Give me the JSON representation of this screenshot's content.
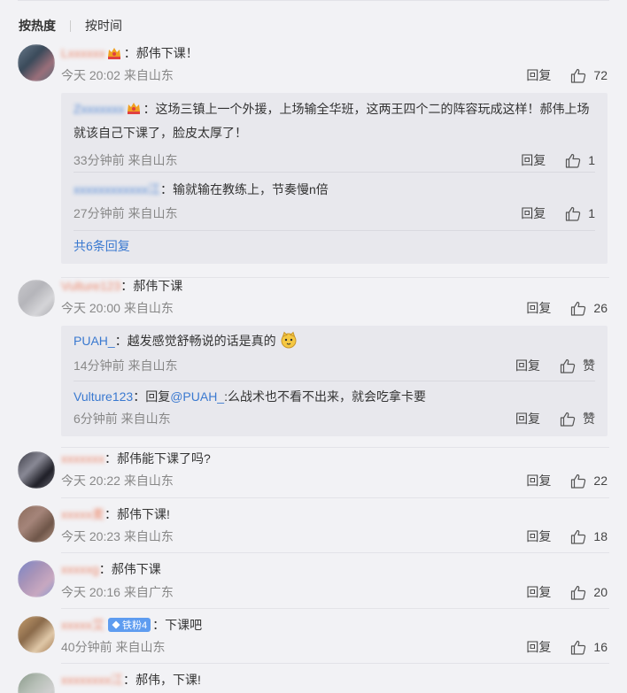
{
  "sort": {
    "hot": "按热度",
    "time": "按时间"
  },
  "comments": [
    {
      "user": "Lxxxxxx",
      "text": "：郝伟下课！",
      "meta": "今天 20:02 来自山东",
      "reply": "回复",
      "likes": "72",
      "avatar_colors": [
        "#6a7b8c",
        "#3a4a5a",
        "#9a6f7a",
        "#5b6b7b"
      ],
      "subreplies": [
        {
          "user": "Zxxxxxxx",
          "text": "：这场三镇上一个外援，上场输全华班，这两王四个二的阵容玩成这样！郝伟上场就该自己下课了，脸皮太厚了！",
          "meta": "33分钟前 来自山东",
          "reply": "回复",
          "likes": "1"
        },
        {
          "user": "xxxxxxxxxxxx江",
          "text": "：输就输在教练上，节奏慢n倍",
          "meta": "27分钟前 来自山东",
          "reply": "回复",
          "likes": "1"
        }
      ],
      "more": "共6条回复"
    },
    {
      "user": "Vulture123",
      "text": "：郝伟下课",
      "meta": "今天 20:00 来自山东",
      "reply": "回复",
      "likes": "26",
      "avatar_colors": [
        "#c8c8cc",
        "#b5b5ba",
        "#d5d5d8",
        "#a9a9ae"
      ],
      "subreplies": [
        {
          "user": "PUAH_",
          "text": "：越发感觉舒畅说的话是真的",
          "meta": "14分钟前 来自山东",
          "reply": "回复",
          "likes": "赞"
        },
        {
          "user": "Vulture123",
          "text": "：回复",
          "mention": "@PUAH_",
          "text2": ":么战术也不看不出来，就会吃拿卡要",
          "meta": "6分钟前 来自山东",
          "reply": "回复",
          "likes": "赞"
        }
      ]
    },
    {
      "user": "xxxxxxx",
      "text": "：郝伟能下课了吗?",
      "meta": "今天 20:22 来自山东",
      "reply": "回复",
      "likes": "22",
      "avatar_colors": [
        "#3a3a44",
        "#8a8a96",
        "#1e1e26",
        "#6c6c78"
      ]
    },
    {
      "user": "xxxxx麦",
      "text": "：郝伟下课!",
      "meta": "今天 20:23 来自山东",
      "reply": "回复",
      "likes": "18",
      "avatar_colors": [
        "#8a6a5a",
        "#a5857a",
        "#6e5548",
        "#b89a8a"
      ]
    },
    {
      "user": "xxxxxg",
      "text": "：郝伟下课",
      "meta": "今天 20:16 来自广东",
      "reply": "回复",
      "likes": "20",
      "avatar_colors": [
        "#7a86c8",
        "#a994b8",
        "#c8a8c0",
        "#8a9ad0"
      ]
    },
    {
      "user": "xxxxx艾",
      "badge": "铁粉4",
      "text": "：下课吧",
      "meta": "40分钟前 来自山东",
      "reply": "回复",
      "likes": "16",
      "avatar_colors": [
        "#c8a070",
        "#8a6a4a",
        "#e0c8a8",
        "#a07850"
      ]
    },
    {
      "user": "xxxxxxxx江",
      "text": "：郝伟，下课!",
      "avatar_colors": [
        "#8a9a8a",
        "#b8c0b8",
        "#d0d0d0",
        "#a0a8a0"
      ]
    }
  ]
}
